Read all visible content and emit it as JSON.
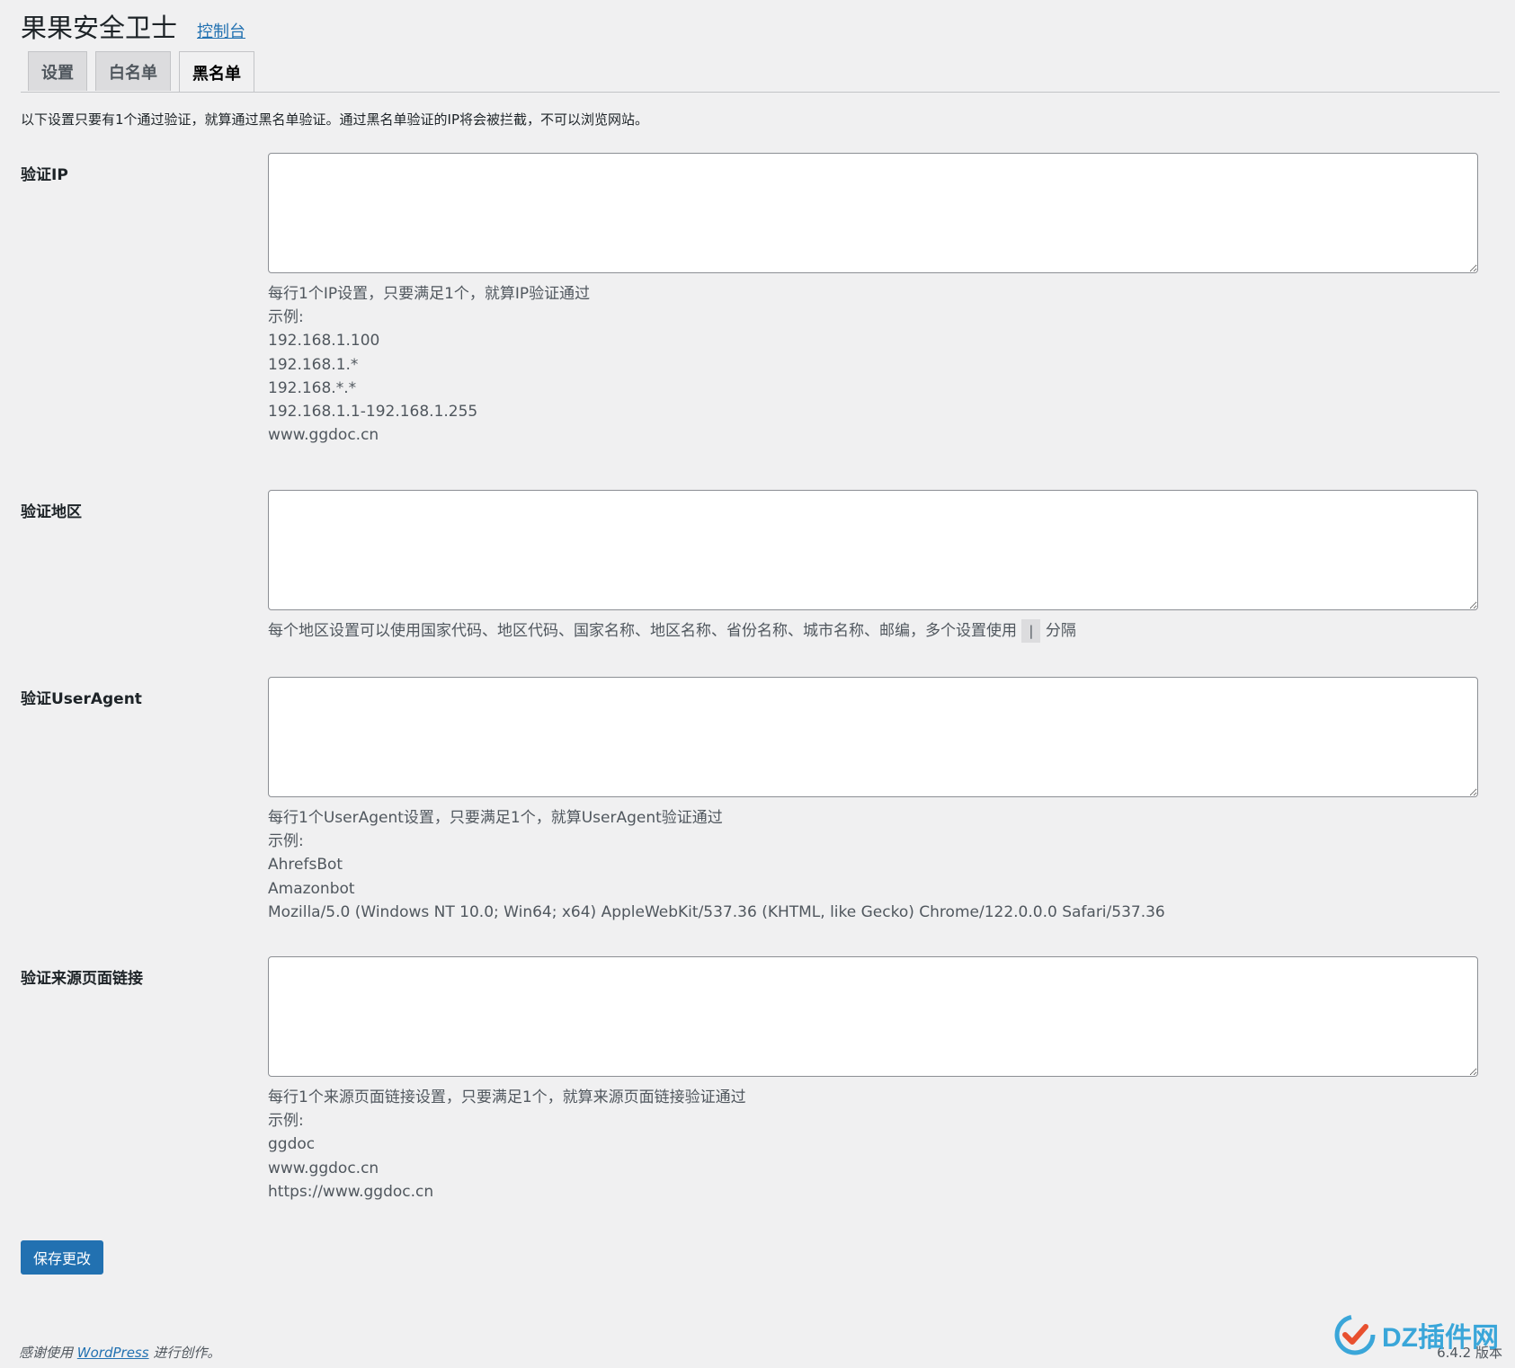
{
  "header": {
    "title": "果果安全卫士",
    "link": "控制台"
  },
  "tabs": [
    {
      "label": "设置",
      "active": false
    },
    {
      "label": "白名单",
      "active": false
    },
    {
      "label": "黑名单",
      "active": true
    }
  ],
  "intro": "以下设置只要有1个通过验证，就算通过黑名单验证。通过黑名单验证的IP将会被拦截，不可以浏览网站。",
  "sections": {
    "ip": {
      "label": "验证IP",
      "value": "",
      "desc": [
        "每行1个IP设置，只要满足1个，就算IP验证通过",
        "示例:",
        "192.168.1.100",
        "192.168.1.*",
        "192.168.*.*",
        "192.168.1.1-192.168.1.255",
        "www.ggdoc.cn"
      ]
    },
    "region": {
      "label": "验证地区",
      "value": "",
      "desc_before": "每个地区设置可以使用国家代码、地区代码、国家名称、地区名称、省份名称、城市名称、邮编，多个设置使用",
      "desc_code": "|",
      "desc_after": "分隔"
    },
    "useragent": {
      "label": "验证UserAgent",
      "value": "",
      "desc": [
        "每行1个UserAgent设置，只要满足1个，就算UserAgent验证通过",
        "示例:",
        "AhrefsBot",
        "Amazonbot",
        "Mozilla/5.0 (Windows NT 10.0; Win64; x64) AppleWebKit/537.36 (KHTML, like Gecko) Chrome/122.0.0.0 Safari/537.36"
      ]
    },
    "referer": {
      "label": "验证来源页面链接",
      "value": "",
      "desc": [
        "每行1个来源页面链接设置，只要满足1个，就算来源页面链接验证通过",
        "示例:",
        "ggdoc",
        "www.ggdoc.cn",
        "https://www.ggdoc.cn"
      ]
    }
  },
  "save_label": "保存更改",
  "footer": {
    "thanks_before": "感谢使用",
    "wp_link": "WordPress",
    "thanks_after": "进行创作。",
    "version": "6.4.2 版本"
  },
  "watermark": {
    "text": "DZ插件网"
  },
  "colors": {
    "primary": "#2271b1",
    "background": "#f0f0f1",
    "text": "#1d2327",
    "muted": "#50575e"
  }
}
